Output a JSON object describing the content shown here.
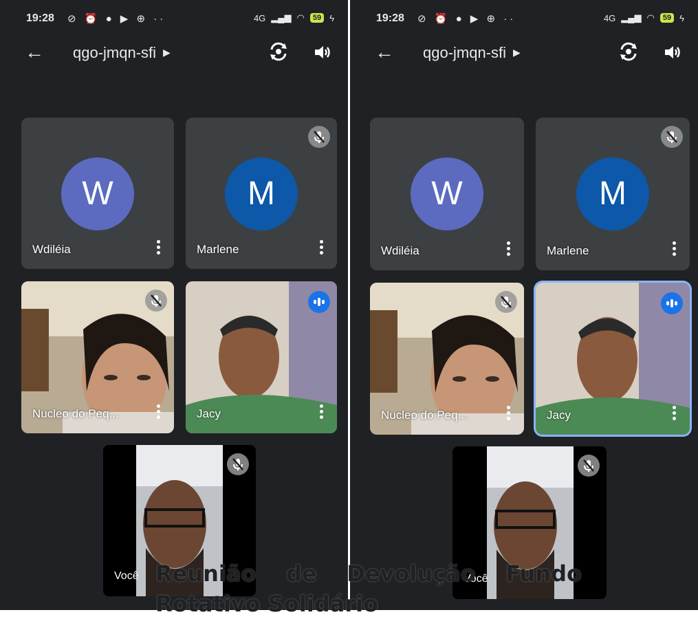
{
  "status": {
    "time": "19:28",
    "signal": "4G",
    "battery": "59"
  },
  "meeting": {
    "code": "qgo-jmqn-sfi"
  },
  "participants": [
    {
      "initial": "W",
      "name": "Wdiléia",
      "muted": false
    },
    {
      "initial": "M",
      "name": "Marlene",
      "muted": true
    },
    {
      "name": "Nucleo do Peq...",
      "muted": true
    },
    {
      "name": "Jacy",
      "speaking": true
    }
  ],
  "self_view": {
    "label": "Você",
    "muted": true
  },
  "caption": "Reunião de Devolução Fundo Rotativo Solidário",
  "colors": {
    "background": "#202124",
    "tile": "#3c4043",
    "avatar_w": "#5c6bc0",
    "avatar_m": "#0d58a8",
    "speaking": "#1a73e8"
  }
}
